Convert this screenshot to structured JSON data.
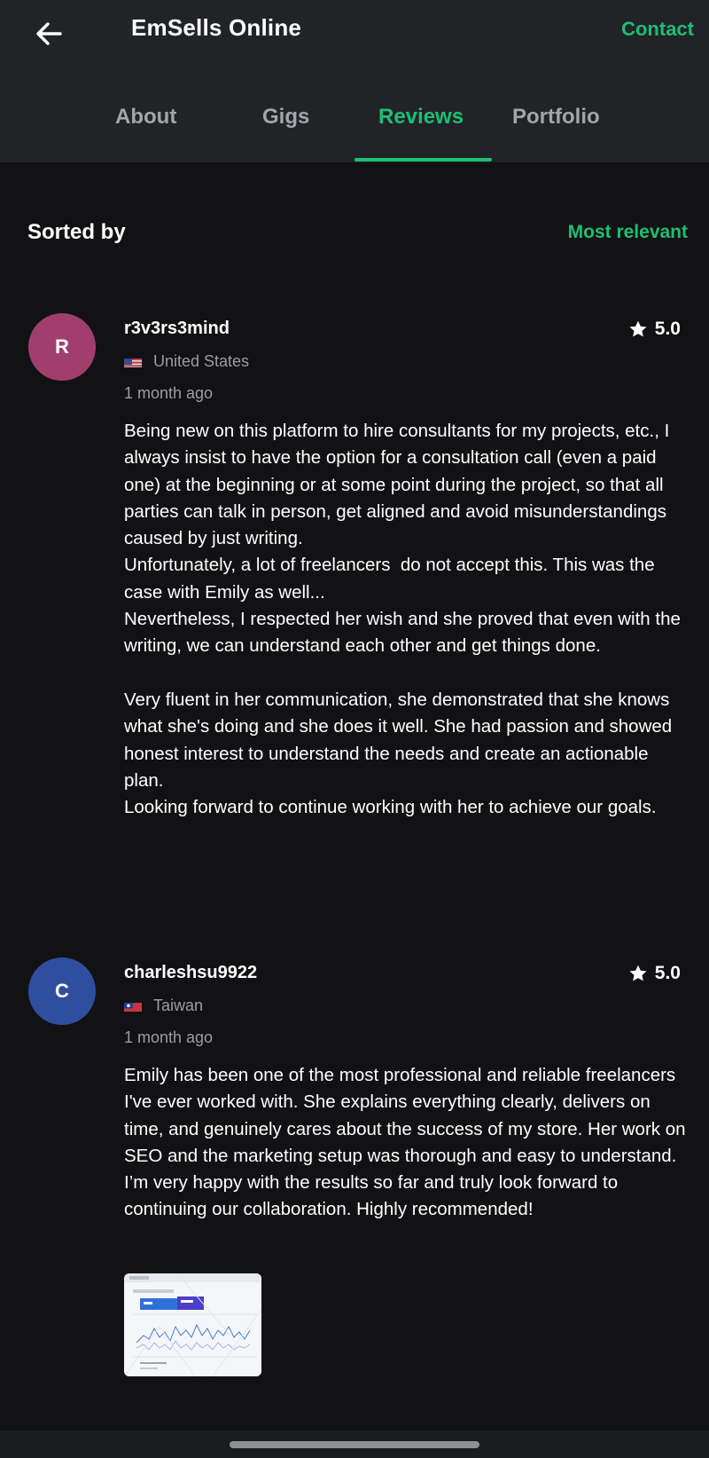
{
  "header": {
    "title": "EmSells Online",
    "contact_label": "Contact",
    "back_icon": "arrow-left-icon"
  },
  "tabs": [
    {
      "label": "About",
      "active": false
    },
    {
      "label": "Gigs",
      "active": false
    },
    {
      "label": "Reviews",
      "active": true
    },
    {
      "label": "Portfolio",
      "active": false
    }
  ],
  "sort": {
    "label": "Sorted by",
    "value": "Most relevant"
  },
  "colors": {
    "accent": "#1dbf73",
    "background": "#121214",
    "header": "#212327"
  },
  "reviews": [
    {
      "initial": "R",
      "avatar_color": "#a03f6e",
      "username": "r3v3rs3mind",
      "rating": "5.0",
      "country": "United States",
      "flag_icon": "us-flag-icon",
      "time": "1 month ago",
      "body": "Being new on this platform to hire consultants for my projects, etc., I always insist to have the option for a consultation call (even a paid one) at the beginning or at some point during the project, so that all parties can talk in person, get aligned and avoid misunderstandings caused by just writing.\nUnfortunately, a lot of freelancers  do not accept this. This was the case with Emily as well...\nNevertheless, I respected her wish and she proved that even with the writing, we can understand each other and get things done.\n\nVery fluent in her communication, she demonstrated that she knows what she's doing and she does it well. She had passion and showed honest interest to understand the needs and create an actionable plan.\nLooking forward to continue working with her to achieve our goals."
    },
    {
      "initial": "C",
      "avatar_color": "#2f4f9e",
      "username": "charleshsu9922",
      "rating": "5.0",
      "country": "Taiwan",
      "flag_icon": "taiwan-flag-icon",
      "time": "1 month ago",
      "body": "Emily has been one of the most professional and reliable freelancers I've ever worked with. She explains everything clearly, delivers on time, and genuinely cares about the success of my store. Her work on SEO and the marketing setup was thorough and easy to understand. I’m very happy with the results so far and truly look forward to continuing our collaboration. Highly recommended!",
      "attachment_icon": "dashboard-screenshot-thumbnail"
    }
  ]
}
